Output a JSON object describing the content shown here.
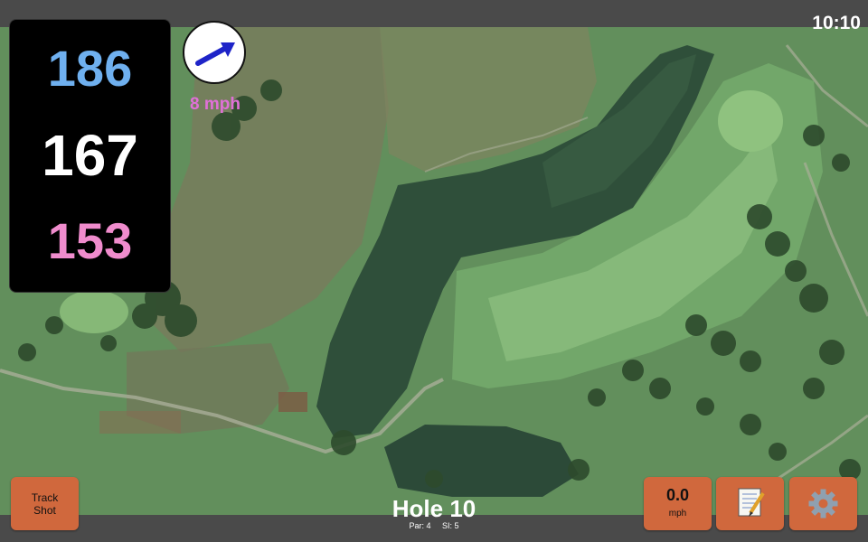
{
  "status": {
    "time": "10:10"
  },
  "yardages": {
    "back": "186",
    "middle": "167",
    "front": "153"
  },
  "wind": {
    "speed_text": "8 mph",
    "icon": "wind-direction-arrow-icon"
  },
  "hole": {
    "title": "Hole 10",
    "par": "Par: 4",
    "stroke_index": "SI: 5"
  },
  "buttons": {
    "track_shot": [
      "Track",
      "Shot"
    ],
    "speed_value": "0.0",
    "speed_unit": "mph",
    "notes_icon": "notepad-icon",
    "settings_icon": "gear-icon"
  },
  "colors": {
    "back": "#6fb0ef",
    "middle": "#ffffff",
    "front": "#f08ccd",
    "wind_text": "#e070d8",
    "button": "#d0683d",
    "bar": "#4a4a4a"
  }
}
